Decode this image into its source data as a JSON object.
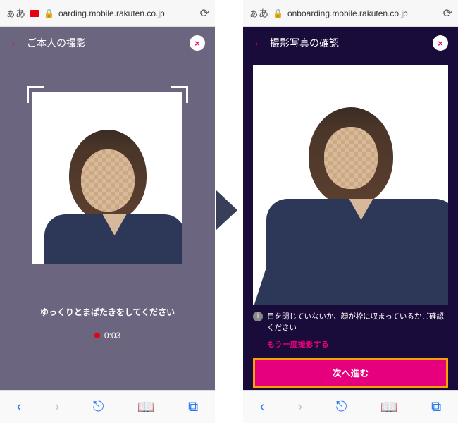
{
  "left": {
    "browser": {
      "aa": "ぁあ",
      "url": "oarding.mobile.rakuten.co.jp"
    },
    "header": {
      "title": "ご本人の撮影"
    },
    "instruction": "ゆっくりとまばたきをしてください",
    "timer": "0:03"
  },
  "right": {
    "browser": {
      "aa": "ぁあ",
      "url": "onboarding.mobile.rakuten.co.jp"
    },
    "header": {
      "title": "撮影写真の確認"
    },
    "confirm": "目を閉じていないか、顔が枠に収まっているかご確認ください",
    "retake": "もう一度撮影する",
    "next": "次へ進む"
  }
}
